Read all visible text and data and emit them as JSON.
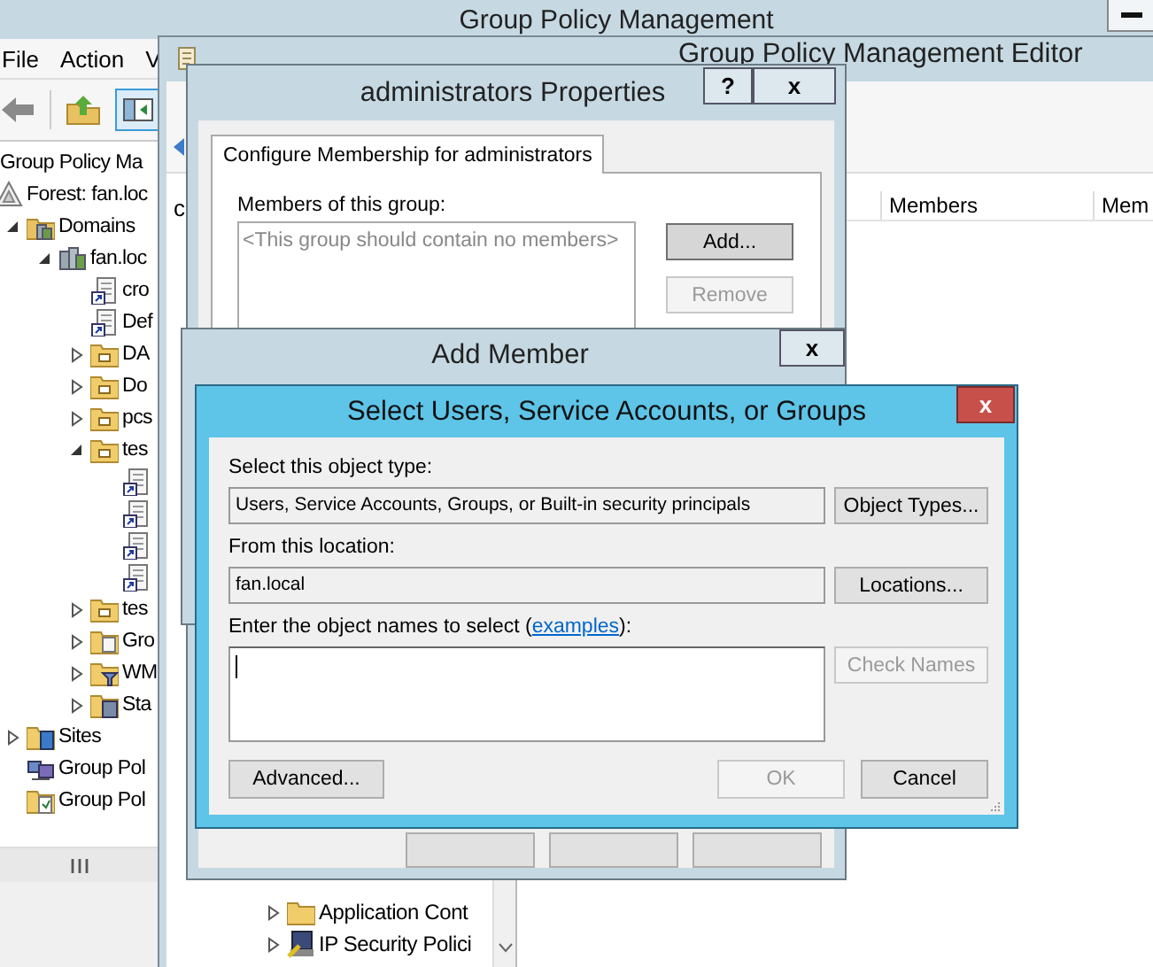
{
  "gpm": {
    "title": "Group Policy Management",
    "menu": [
      "File",
      "Action",
      "V"
    ],
    "tree": [
      {
        "label": "Group Policy Ma",
        "kind": "console",
        "children": [
          {
            "label": "Forest: fan.loc",
            "kind": "forest",
            "children": [
              {
                "label": "Domains",
                "kind": "domains",
                "expanded": true,
                "children": [
                  {
                    "label": "fan.loc",
                    "kind": "domain",
                    "expanded": true,
                    "children": [
                      {
                        "label": "cro",
                        "kind": "gpo-link"
                      },
                      {
                        "label": "Def",
                        "kind": "gpo-link"
                      },
                      {
                        "label": "DA",
                        "kind": "ou",
                        "expanded": false
                      },
                      {
                        "label": "Do",
                        "kind": "ou",
                        "expanded": false
                      },
                      {
                        "label": "pcs",
                        "kind": "ou",
                        "expanded": false
                      },
                      {
                        "label": "tes",
                        "kind": "ou",
                        "expanded": true,
                        "children": [
                          {
                            "kind": "gpo-link"
                          },
                          {
                            "kind": "gpo-link"
                          },
                          {
                            "kind": "gpo-link"
                          },
                          {
                            "kind": "gpo-link"
                          }
                        ]
                      },
                      {
                        "label": "tes",
                        "kind": "ou",
                        "expanded": false
                      },
                      {
                        "label": "Gro",
                        "kind": "gpo-folder",
                        "expanded": false
                      },
                      {
                        "label": "WM",
                        "kind": "filter-folder",
                        "expanded": false
                      },
                      {
                        "label": "Sta",
                        "kind": "starter-folder",
                        "expanded": false
                      }
                    ]
                  }
                ]
              },
              {
                "label": "Sites",
                "kind": "sites",
                "expanded": false
              },
              {
                "label": "Group Pol",
                "kind": "modeling"
              },
              {
                "label": "Group Pol",
                "kind": "results"
              }
            ]
          }
        ]
      }
    ]
  },
  "editor": {
    "title": "Group Policy Management Editor",
    "pane_fragment": "c",
    "columns": [
      {
        "label": "Members"
      },
      {
        "label": "Mem"
      }
    ],
    "tree": [
      {
        "label": "Application Cont",
        "kind": "folder",
        "expanded": false
      },
      {
        "label": "IP Security Polici",
        "kind": "ipsec",
        "expanded": false
      }
    ]
  },
  "properties": {
    "title": "administrators Properties",
    "help": "?",
    "close": "x",
    "tab": {
      "label": "Configure Membership for administrators",
      "selected": true
    },
    "members_label": "Members of this group:",
    "members_placeholder": "<This group should contain no members>",
    "buttons": [
      {
        "label": "Add...",
        "disabled": false
      },
      {
        "label": "Remove",
        "disabled": true
      }
    ]
  },
  "add_member": {
    "title": "Add Member",
    "close": "x"
  },
  "select_dialog": {
    "title": "Select Users, Service Accounts, or Groups",
    "close": "x",
    "type_label": "Select this object type:",
    "type_value": "Users, Service Accounts, Groups, or Built-in security principals",
    "type_button": {
      "label": "Object Types...",
      "disabled": false
    },
    "location_label": "From this location:",
    "location_value": "fan.local",
    "location_button": {
      "label": "Locations...",
      "disabled": false
    },
    "names_label": {
      "before": "Enter the object names to select (",
      "link": "examples",
      "after": "):"
    },
    "check_button": {
      "label": "Check Names",
      "disabled": true
    },
    "advanced_button": {
      "label": "Advanced...",
      "disabled": false
    },
    "footer_buttons": [
      {
        "label": "OK",
        "disabled": true
      },
      {
        "label": "Cancel",
        "disabled": false
      }
    ]
  }
}
